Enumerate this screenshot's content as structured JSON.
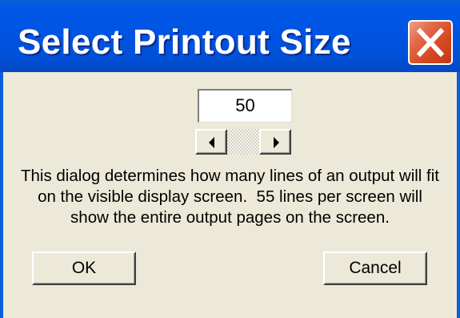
{
  "window": {
    "title": "Select Printout Size",
    "close_icon": "close-icon",
    "accent_color": "#0054e3",
    "close_color": "#d4481f"
  },
  "printout_size": {
    "value": "50",
    "decrement_icon": "arrow-left-icon",
    "increment_icon": "arrow-right-icon"
  },
  "description": "This dialog determines how many lines of an output will fit\non the visible display screen.  55 lines per screen will\nshow the entire output pages on the screen.",
  "buttons": {
    "ok_label": "OK",
    "cancel_label": "Cancel"
  }
}
